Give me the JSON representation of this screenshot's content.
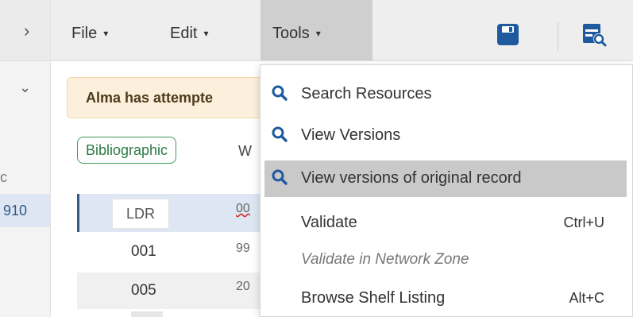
{
  "left_panel": {
    "expand_glyph": "›",
    "collapse_glyph": "⌄",
    "partial_letter": "c",
    "partial_value": "910"
  },
  "toolbar": {
    "file_label": "File",
    "edit_label": "Edit",
    "tools_label": "Tools",
    "caret": "▾",
    "icons": [
      "save-icon",
      "view-record-icon"
    ],
    "accent_color": "#1f5a9e"
  },
  "editor": {
    "alert_text": "Alma has attempte",
    "tab_bibliographic": "Bibliographic",
    "tab_partial": "W",
    "rows": [
      {
        "tag": "LDR",
        "value": "00"
      },
      {
        "tag": "001",
        "value": "99"
      },
      {
        "tag": "005",
        "value": "20"
      }
    ]
  },
  "tools_menu": {
    "items": [
      {
        "label": "Search Resources",
        "icon": "search-icon",
        "shortcut": ""
      },
      {
        "label": "View Versions",
        "icon": "search-icon",
        "shortcut": ""
      },
      {
        "label": "View versions of original record",
        "icon": "search-icon",
        "shortcut": ""
      },
      {
        "label": "Validate",
        "icon": "",
        "shortcut": "Ctrl+U"
      },
      {
        "label": "Validate in Network Zone",
        "icon": "",
        "shortcut": ""
      },
      {
        "label": "Browse Shelf Listing",
        "icon": "",
        "shortcut": "Alt+C"
      }
    ]
  }
}
